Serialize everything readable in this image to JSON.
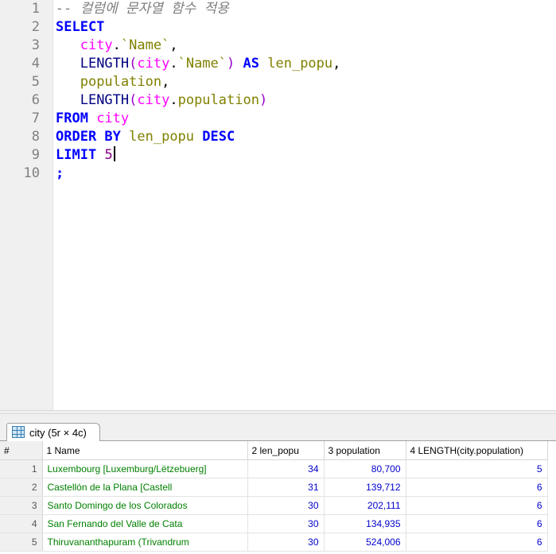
{
  "editor": {
    "line_numbers": [
      "1",
      "2",
      "3",
      "4",
      "5",
      "6",
      "7",
      "8",
      "9",
      "10"
    ],
    "comment": "-- 컬럼에 문자열 함수 적용",
    "kw_select": "SELECT",
    "l3_table": "city",
    "l3_dot": ".",
    "l3_col": "`Name`",
    "l3_comma": ",",
    "l4_fn": "LENGTH",
    "l4_open": "(",
    "l4_table": "city",
    "l4_dot": ".",
    "l4_col": "`Name`",
    "l4_close": ")",
    "l4_as": "AS",
    "l4_alias": "len_popu",
    "l4_comma": ",",
    "l5_col": "population",
    "l5_comma": ",",
    "l6_fn": "LENGTH",
    "l6_open": "(",
    "l6_table": "city",
    "l6_dot": ".",
    "l6_col": "population",
    "l6_close": ")",
    "kw_from": "FROM",
    "l7_table": "city",
    "kw_order_by": "ORDER BY",
    "l8_col": "len_popu",
    "kw_desc": "DESC",
    "kw_limit": "LIMIT",
    "l9_num": "5",
    "l10_semi": ";"
  },
  "results_tab": {
    "label": "city (5r × 4c)",
    "icon": "table-grid-icon"
  },
  "grid": {
    "headers": {
      "rownum": "#",
      "c1": "1 Name",
      "c2": "2 len_popu",
      "c3": "3 population",
      "c4": "4 LENGTH(city.population)"
    },
    "rows": [
      {
        "n": "1",
        "name": "Luxembourg [Luxemburg/Lëtzebuerg]",
        "len": "34",
        "pop": "80,700",
        "lenpop": "5"
      },
      {
        "n": "2",
        "name": "Castellón de la Plana [Castell",
        "len": "31",
        "pop": "139,712",
        "lenpop": "6"
      },
      {
        "n": "3",
        "name": "Santo Domingo de los Colorados",
        "len": "30",
        "pop": "202,111",
        "lenpop": "6"
      },
      {
        "n": "4",
        "name": "San Fernando del Valle de Cata",
        "len": "30",
        "pop": "134,935",
        "lenpop": "6"
      },
      {
        "n": "5",
        "name": "Thiruvananthapuram (Trivandrum",
        "len": "30",
        "pop": "524,006",
        "lenpop": "6"
      }
    ]
  }
}
